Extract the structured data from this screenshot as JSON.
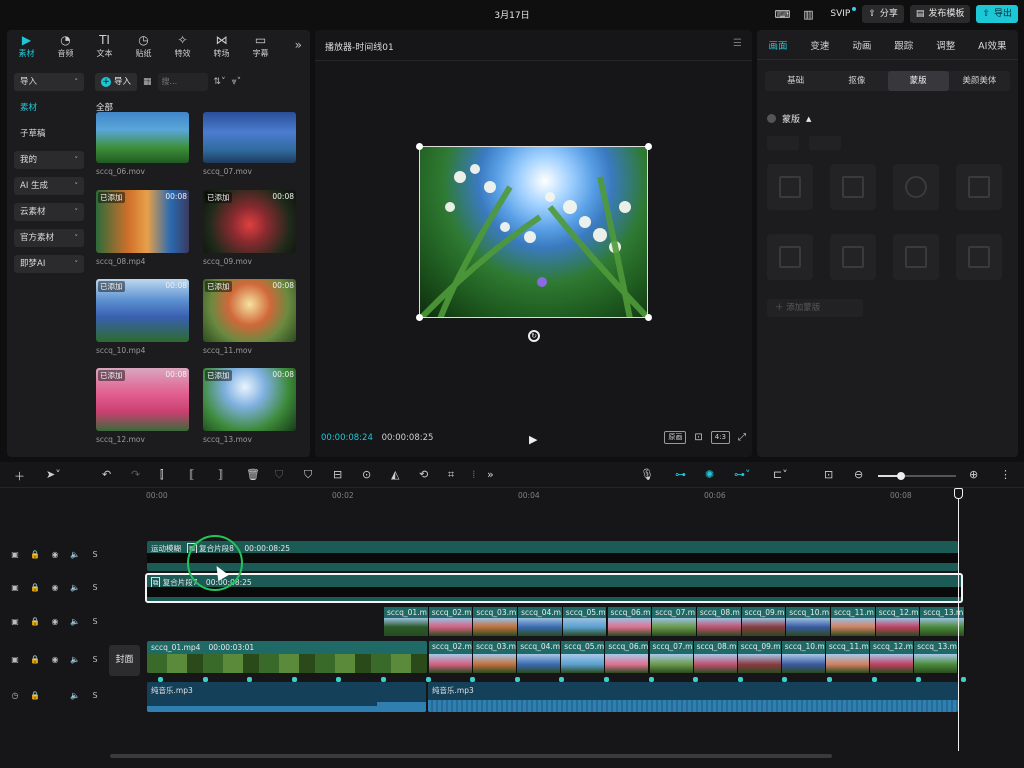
{
  "topbar": {
    "date": "3月17日",
    "svip": "SVIP",
    "share": "分享",
    "publish_template": "发布模板",
    "export": "导出"
  },
  "media": {
    "tabs": [
      {
        "label": "素材",
        "icon": "media-icon"
      },
      {
        "label": "音频",
        "icon": "audio-icon"
      },
      {
        "label": "文本",
        "icon": "text-icon"
      },
      {
        "label": "贴纸",
        "icon": "sticker-icon"
      },
      {
        "label": "特效",
        "icon": "effects-icon"
      },
      {
        "label": "转场",
        "icon": "transition-icon"
      },
      {
        "label": "字幕",
        "icon": "subtitle-icon"
      }
    ],
    "nav": {
      "import": "导入",
      "media": "素材",
      "draft": "子草稿",
      "mine": "我的",
      "ai_gen": "AI 生成",
      "cloud": "云素材",
      "official": "官方素材",
      "jimeng": "即梦AI"
    },
    "import_button": "导入",
    "search_placeholder": "搜...",
    "all_label": "全部",
    "clips": [
      {
        "name": "sccq_06.mov",
        "added": "",
        "duration": ""
      },
      {
        "name": "sccq_07.mov",
        "added": "",
        "duration": ""
      },
      {
        "name": "sccq_08.mp4",
        "added": "已添加",
        "duration": "00:08"
      },
      {
        "name": "sccq_09.mov",
        "added": "已添加",
        "duration": "00:08"
      },
      {
        "name": "sccq_10.mp4",
        "added": "已添加",
        "duration": "00:08"
      },
      {
        "name": "sccq_11.mov",
        "added": "已添加",
        "duration": "00:08"
      },
      {
        "name": "sccq_12.mov",
        "added": "已添加",
        "duration": "00:08"
      },
      {
        "name": "sccq_13.mov",
        "added": "已添加",
        "duration": "00:08"
      }
    ]
  },
  "player": {
    "title": "播放器-时间线01",
    "current_time": "00:00:08:24",
    "total_time": "00:00:08:25",
    "original_label": "原画",
    "ratio_label": "4:3"
  },
  "props": {
    "tabs": [
      "画面",
      "变速",
      "动画",
      "跟踪",
      "调整",
      "AI效果"
    ],
    "sub_tabs": [
      "基础",
      "抠像",
      "蒙版",
      "美颜美体"
    ],
    "mask_label": "蒙版",
    "add_mask": "添加蒙版"
  },
  "timeline": {
    "ruler": [
      "00:00",
      "00:02",
      "00:04",
      "00:06",
      "00:08"
    ],
    "cover_label": "封面",
    "compound8_label": "运动模糊",
    "compound8_name": "复合片段8",
    "compound8_duration": "00:00:08:25",
    "compound7_name": "复合片段7",
    "compound7_duration": "00:00:08:25",
    "overlay_clips": [
      "sccq_01.m",
      "sccq_02.m",
      "sccq_03.m",
      "sccq_04.m",
      "sccq_05.m",
      "sccq_06.m",
      "sccq_07.m",
      "sccq_08.m",
      "sccq_09.m",
      "sccq_10.m",
      "sccq_11.m",
      "sccq_12.m",
      "sccq_13.m"
    ],
    "main_first_clip": "sccq_01.mp4",
    "main_first_duration": "00:00:03:01",
    "main_clips": [
      "sccq_02.m",
      "sccq_03.m",
      "sccq_04.m",
      "sccq_05.m",
      "sccq_06.m",
      "sccq_07.m",
      "sccq_08.m",
      "sccq_09.m",
      "sccq_10.m",
      "sccq_11.m",
      "sccq_12.m",
      "sccq_13.m"
    ],
    "audio_1": "纯音乐.mp3",
    "audio_2": "纯音乐.mp3"
  }
}
